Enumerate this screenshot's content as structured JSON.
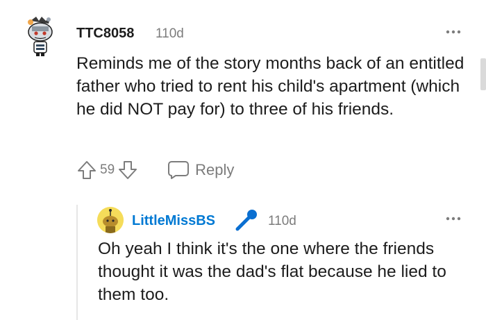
{
  "comment": {
    "username": "TTC8058",
    "time": "110d",
    "body": "Reminds me of the story months back of an entitled father who tried to rent his child's apartment (which he did NOT pay for) to three of his friends.",
    "votes": "59",
    "reply_label": "Reply"
  },
  "reply": {
    "username": "LittleMissBS",
    "time": "110d",
    "body": "Oh yeah I think it's the one where the friends thought it was the dad's flat because he lied to them too."
  },
  "colors": {
    "username_reply": "#0079d3",
    "meta_gray": "#7c7c7c",
    "avatar_reply_bg": "#f5dc5a"
  }
}
